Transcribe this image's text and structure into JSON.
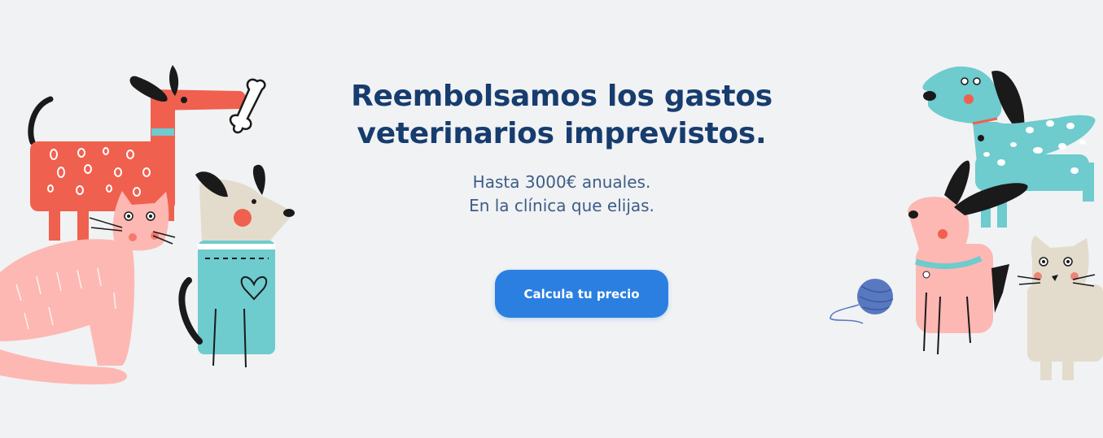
{
  "hero": {
    "title_line1": "Reembolsamos los gastos",
    "title_line2": "veterinarios imprevistos.",
    "subtitle_line1": "Hasta 3000€ anuales.",
    "subtitle_line2": "En la clínica que elijas.",
    "cta_label": "Calcula tu precio"
  },
  "colors": {
    "background": "#f1f2f4",
    "title": "#173c6e",
    "subtitle": "#3d5d86",
    "cta": "#2b7fe0",
    "red_dog": "#f0604e",
    "pink_cat": "#fdb8b3",
    "teal": "#6ecbce",
    "beige": "#e3dccc"
  },
  "illustrations": {
    "left": [
      "red-dog-icon",
      "bone-icon",
      "pink-cat-icon",
      "beige-dog-icon"
    ],
    "right": [
      "dalmatian-dog-icon",
      "pink-dog-icon",
      "yarn-ball-icon",
      "beige-cat-icon"
    ]
  }
}
